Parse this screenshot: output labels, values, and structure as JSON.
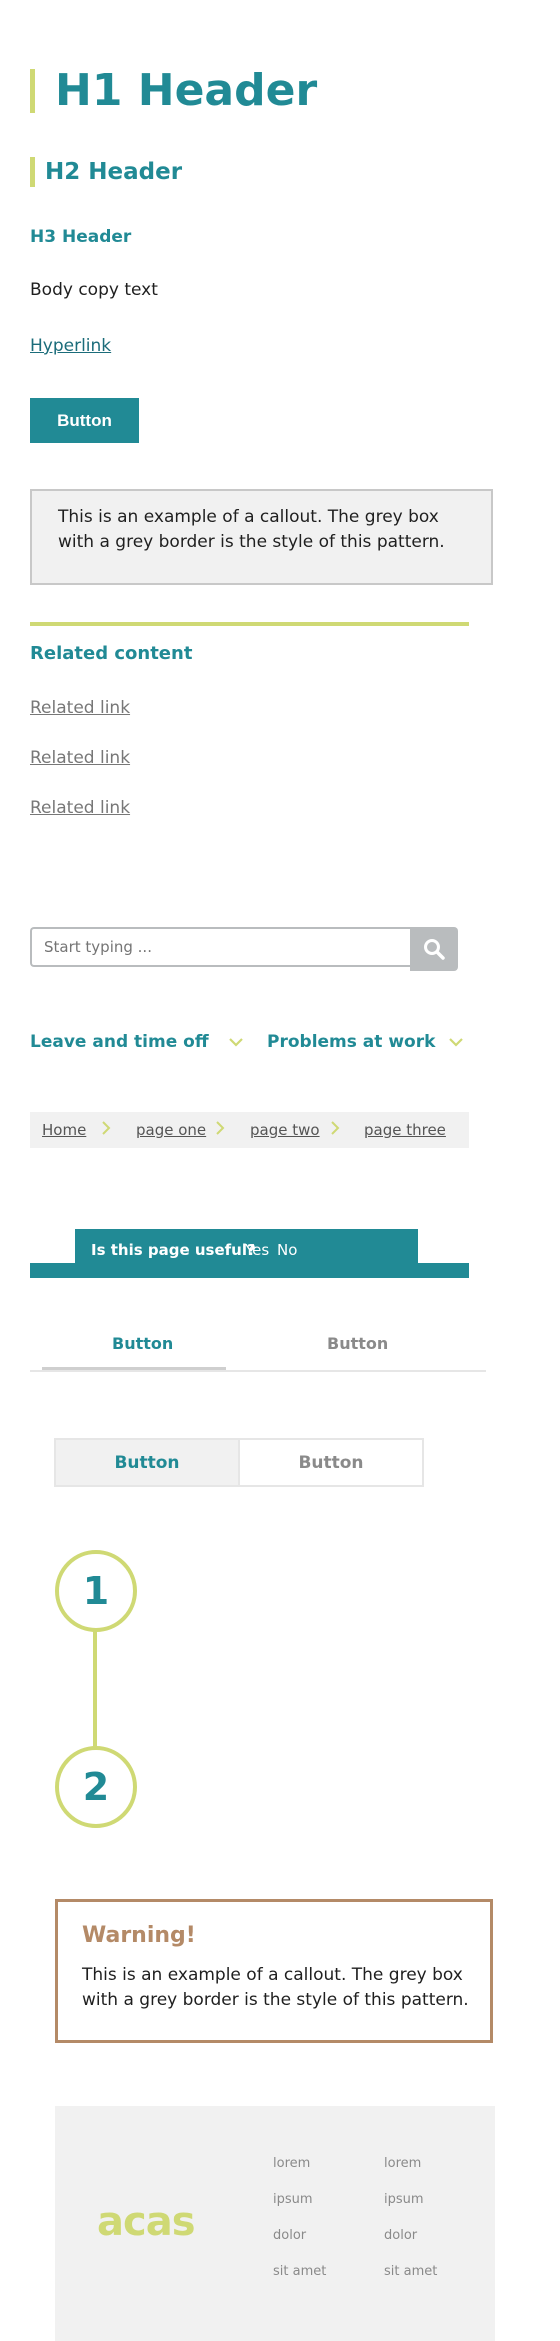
{
  "headers": {
    "h1": "H1 Header",
    "h2": "H2 Header",
    "h3": "H3 Header"
  },
  "body_copy": "Body copy text",
  "hyperlink": "Hyperlink",
  "button_label": "Button",
  "callout_text": "This is an example of a callout. The grey box with a grey border is the style of this pattern.",
  "related": {
    "title": "Related content",
    "links": [
      "Related link",
      "Related link",
      "Related link"
    ]
  },
  "search": {
    "placeholder": "Start typing ..."
  },
  "nav_dropdowns": [
    "Leave and time off",
    "Problems at work"
  ],
  "breadcrumbs": [
    "Home",
    "page one",
    "page two",
    "page three"
  ],
  "feedback": {
    "question": "Is this page useful?",
    "yes": "Yes",
    "no": "No"
  },
  "tabs": [
    "Button",
    "Button"
  ],
  "segmented": [
    "Button",
    "Button"
  ],
  "steps": [
    "1",
    "2"
  ],
  "warning": {
    "title": "Warning!",
    "body": "This is an example of a callout. The grey box with a grey border is the style of this pattern."
  },
  "footer": {
    "logo_text": "acas",
    "col1": [
      "lorem",
      "ipsum",
      "dolor",
      "sit amet"
    ],
    "col2": [
      "lorem",
      "ipsum",
      "dolor",
      "sit amet"
    ]
  },
  "colors": {
    "teal": "#218a95",
    "lime": "#cfd974",
    "warning": "#b48a67",
    "grey_bg": "#f1f1f1"
  }
}
